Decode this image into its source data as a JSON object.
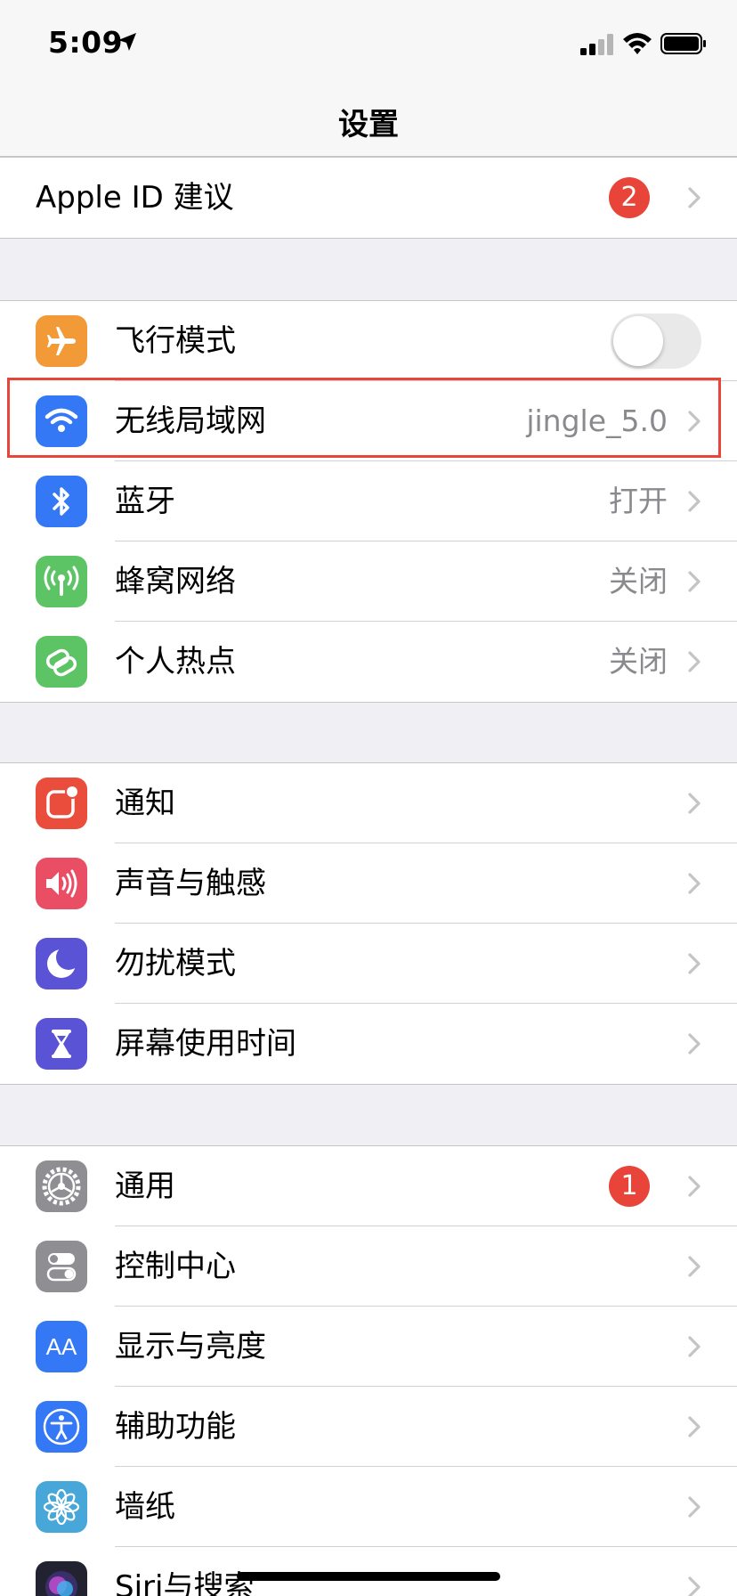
{
  "status_bar": {
    "time": "5:09"
  },
  "nav": {
    "title": "设置"
  },
  "apple_id": {
    "label": "Apple ID 建议",
    "badge": "2"
  },
  "connectivity": [
    {
      "label": "飞行模式",
      "icon": "airplane-icon",
      "color": "#f29a38",
      "toggle": "off"
    },
    {
      "label": "无线局域网",
      "icon": "wifi-icon",
      "color": "#3478f6",
      "value": "jingle_5.0"
    },
    {
      "label": "蓝牙",
      "icon": "bluetooth-icon",
      "color": "#3478f6",
      "value": "打开"
    },
    {
      "label": "蜂窝网络",
      "icon": "cellular-icon",
      "color": "#5dc466",
      "value": "关闭"
    },
    {
      "label": "个人热点",
      "icon": "hotspot-icon",
      "color": "#5dc466",
      "value": "关闭"
    }
  ],
  "notifications_group": [
    {
      "label": "通知",
      "icon": "notifications-icon",
      "color": "#eb4d3d"
    },
    {
      "label": "声音与触感",
      "icon": "sounds-icon",
      "color": "#ea4e65"
    },
    {
      "label": "勿扰模式",
      "icon": "moon-icon",
      "color": "#5a53d6"
    },
    {
      "label": "屏幕使用时间",
      "icon": "hourglass-icon",
      "color": "#5a53d6"
    }
  ],
  "general_group": [
    {
      "label": "通用",
      "icon": "gear-icon",
      "color": "#8e8e93",
      "badge": "1"
    },
    {
      "label": "控制中心",
      "icon": "control-center-icon",
      "color": "#8e8e93"
    },
    {
      "label": "显示与亮度",
      "icon": "display-icon",
      "color": "#3478f6",
      "icon_text": "AA"
    },
    {
      "label": "辅助功能",
      "icon": "accessibility-icon",
      "color": "#3478f6"
    },
    {
      "label": "墙纸",
      "icon": "wallpaper-icon",
      "color": "#46a7d8"
    },
    {
      "label": "Siri与搜索",
      "icon": "siri-icon",
      "color": "#222230"
    }
  ]
}
